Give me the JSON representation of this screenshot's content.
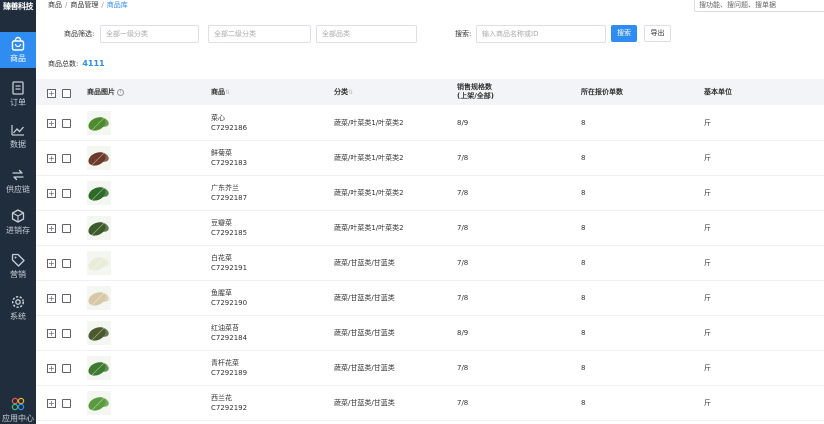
{
  "brand": "臻善科技",
  "sidebar": {
    "items": [
      {
        "label": "商品",
        "icon": "bag-icon"
      },
      {
        "label": "订单",
        "icon": "document-icon"
      },
      {
        "label": "数据",
        "icon": "chart-line-icon"
      },
      {
        "label": "供应链",
        "icon": "exchange-icon"
      },
      {
        "label": "进销存",
        "icon": "box-icon"
      },
      {
        "label": "营销",
        "icon": "tag-icon"
      },
      {
        "label": "系统",
        "icon": "gear-icon"
      },
      {
        "label": "应用中心",
        "icon": "apps-icon"
      }
    ]
  },
  "breadcrumb": [
    "商品",
    "商品管理",
    "商品库"
  ],
  "top_search": {
    "placeholder": "搜功能、搜问题、搜单据"
  },
  "filter": {
    "label": "商品筛选:",
    "level1_placeholder": "全部一级分类",
    "level2_placeholder": "全部二级分类",
    "brand_placeholder": "全部品类",
    "search_label": "搜索:",
    "search_placeholder": "输入商品名称或ID",
    "search_button": "搜索",
    "export_button": "导出"
  },
  "summary": {
    "label": "商品总数:",
    "count": "4111"
  },
  "table": {
    "headers": {
      "image": "商品图片",
      "product": "商品",
      "category": "分类",
      "spec_line1": "销售规格数",
      "spec_line2": "(上架/全部)",
      "quote_count": "所在报价单数",
      "unit": "基本单位"
    },
    "rows": [
      {
        "name": "菜心",
        "code": "C7292186",
        "category": "蔬菜/叶菜类1/叶菜类2",
        "spec": "8/9",
        "quotes": "8",
        "unit": "斤",
        "thumb_color": "#4e8a2e"
      },
      {
        "name": "鲜菊菜",
        "code": "C7292183",
        "category": "蔬菜/叶菜类1/叶菜类2",
        "spec": "7/8",
        "quotes": "8",
        "unit": "斤",
        "thumb_color": "#6b3a2a"
      },
      {
        "name": "广东芥兰",
        "code": "C7292187",
        "category": "蔬菜/叶菜类1/叶菜类2",
        "spec": "7/8",
        "quotes": "8",
        "unit": "斤",
        "thumb_color": "#2f6b28"
      },
      {
        "name": "豆瓣菜",
        "code": "C7292185",
        "category": "蔬菜/叶菜类1/叶菜类2",
        "spec": "7/8",
        "quotes": "8",
        "unit": "斤",
        "thumb_color": "#3d5a2a"
      },
      {
        "name": "白花菜",
        "code": "C7292191",
        "category": "蔬菜/甘蓝类/甘蓝类",
        "spec": "7/8",
        "quotes": "8",
        "unit": "斤",
        "thumb_color": "#e8ecd8"
      },
      {
        "name": "鱼腥草",
        "code": "C7292190",
        "category": "蔬菜/甘蓝类/甘蓝类",
        "spec": "7/8",
        "quotes": "8",
        "unit": "斤",
        "thumb_color": "#d8c8a8"
      },
      {
        "name": "红油菜苔",
        "code": "C7292184",
        "category": "蔬菜/甘蓝类/甘蓝类",
        "spec": "8/9",
        "quotes": "8",
        "unit": "斤",
        "thumb_color": "#4a5a2e"
      },
      {
        "name": "青杆花菜",
        "code": "C7292189",
        "category": "蔬菜/甘蓝类/甘蓝类",
        "spec": "7/8",
        "quotes": "8",
        "unit": "斤",
        "thumb_color": "#3f7a30"
      },
      {
        "name": "西兰花",
        "code": "C7292192",
        "category": "蔬菜/甘蓝类/甘蓝类",
        "spec": "7/8",
        "quotes": "8",
        "unit": "斤",
        "thumb_color": "#5a9a40"
      }
    ]
  },
  "colors": {
    "accent": "#2f8cf0",
    "sidebar": "#1f2d3d"
  }
}
